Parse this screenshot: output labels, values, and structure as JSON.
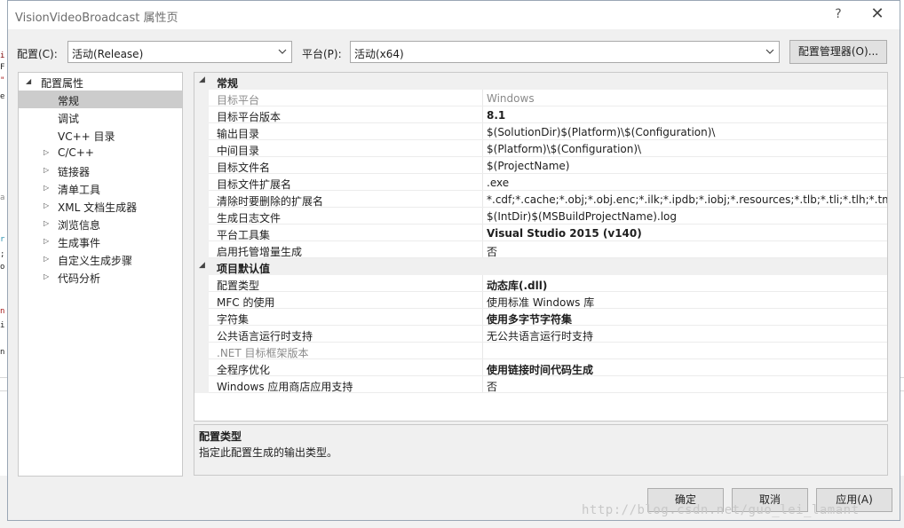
{
  "window": {
    "title": "VisionVideoBroadcast 属性页",
    "help_glyph": "?",
    "close_glyph": "✕"
  },
  "toolbar": {
    "config_label": "配置(C):",
    "config_value": "活动(Release)",
    "platform_label": "平台(P):",
    "platform_value": "活动(x64)",
    "config_manager_label": "配置管理器(O)..."
  },
  "tree": {
    "root": "配置属性",
    "items": [
      {
        "label": "常规"
      },
      {
        "label": "调试"
      },
      {
        "label": "VC++ 目录"
      },
      {
        "label": "C/C++"
      },
      {
        "label": "链接器"
      },
      {
        "label": "清单工具"
      },
      {
        "label": "XML 文档生成器"
      },
      {
        "label": "浏览信息"
      },
      {
        "label": "生成事件"
      },
      {
        "label": "自定义生成步骤"
      },
      {
        "label": "代码分析"
      }
    ]
  },
  "grid": {
    "categories": [
      {
        "label": "常规"
      },
      {
        "label": "项目默认值"
      }
    ],
    "general_rows": [
      {
        "name": "目标平台",
        "value": "Windows"
      },
      {
        "name": "目标平台版本",
        "value": "8.1"
      },
      {
        "name": "输出目录",
        "value": "$(SolutionDir)$(Platform)\\$(Configuration)\\"
      },
      {
        "name": "中间目录",
        "value": "$(Platform)\\$(Configuration)\\"
      },
      {
        "name": "目标文件名",
        "value": "$(ProjectName)"
      },
      {
        "name": "目标文件扩展名",
        "value": ".exe"
      },
      {
        "name": "清除时要删除的扩展名",
        "value": "*.cdf;*.cache;*.obj;*.obj.enc;*.ilk;*.ipdb;*.iobj;*.resources;*.tlb;*.tli;*.tlh;*.tmp;*.rsp"
      },
      {
        "name": "生成日志文件",
        "value": "$(IntDir)$(MSBuildProjectName).log"
      },
      {
        "name": "平台工具集",
        "value": "Visual Studio 2015 (v140)"
      },
      {
        "name": "启用托管增量生成",
        "value": "否"
      }
    ],
    "defaults_rows": [
      {
        "name": "配置类型",
        "value": "动态库(.dll)"
      },
      {
        "name": "MFC 的使用",
        "value": "使用标准 Windows 库"
      },
      {
        "name": "字符集",
        "value": "使用多字节字符集"
      },
      {
        "name": "公共语言运行时支持",
        "value": "无公共语言运行时支持"
      },
      {
        "name": ".NET 目标框架版本",
        "value": ""
      },
      {
        "name": "全程序优化",
        "value": "使用链接时间代码生成"
      },
      {
        "name": "Windows 应用商店应用支持",
        "value": "否"
      }
    ]
  },
  "description": {
    "title": "配置类型",
    "text": "指定此配置生成的输出类型。"
  },
  "buttons": {
    "ok": "确定",
    "cancel": "取消",
    "apply": "应用(A)"
  },
  "watermark": "http://blog.csdn.net/guo_lei_lamant",
  "background_editor_glyphs": [
    "i",
    "F",
    "\"",
    "e",
    "a",
    "r",
    ";",
    "o",
    "n",
    "i",
    "n"
  ],
  "colors": {
    "selection": "#cccccc",
    "dialog_bg": "#f0f0f0",
    "border": "#c9c9c9"
  }
}
